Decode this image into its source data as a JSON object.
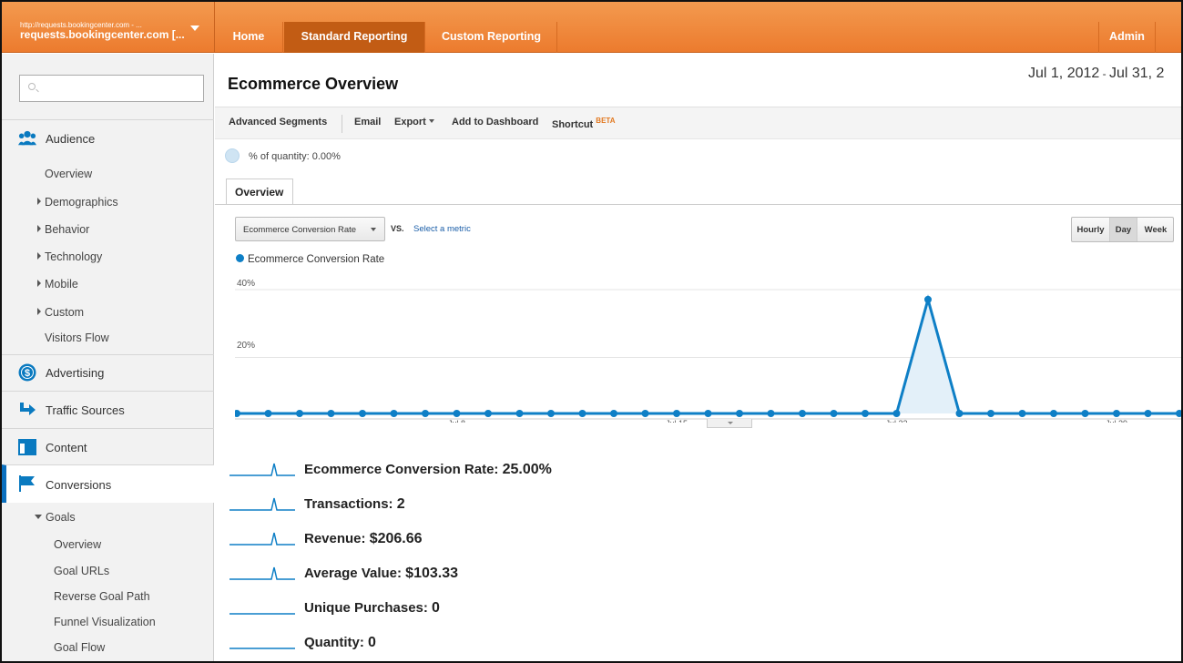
{
  "account": {
    "url": "http://requests.bookingcenter.com - ...",
    "name": "requests.bookingcenter.com [..."
  },
  "nav": {
    "home": "Home",
    "standard": "Standard Reporting",
    "custom": "Custom Reporting",
    "admin": "Admin"
  },
  "sidebar": {
    "search_placeholder": "",
    "audience": "Audience",
    "audience_items": [
      "Overview",
      "Demographics",
      "Behavior",
      "Technology",
      "Mobile",
      "Custom",
      "Visitors Flow"
    ],
    "advertising": "Advertising",
    "traffic": "Traffic Sources",
    "content": "Content",
    "conversions": "Conversions",
    "goals": "Goals",
    "goals_items": [
      "Overview",
      "Goal URLs",
      "Reverse Goal Path",
      "Funnel Visualization",
      "Goal Flow"
    ]
  },
  "page": {
    "title": "Ecommerce Overview",
    "date_start": "Jul 1, 2012",
    "date_sep": " - ",
    "date_end": "Jul 31, 2"
  },
  "toolbar": {
    "segments": "Advanced Segments",
    "email": "Email",
    "export": "Export",
    "dashboard": "Add to Dashboard",
    "shortcut": "Shortcut",
    "beta": "BETA"
  },
  "pct_quantity": "% of quantity: 0.00%",
  "tab": "Overview",
  "metric_select": "Ecommerce Conversion Rate",
  "vs": "VS.",
  "select_metric": "Select a metric",
  "granularity": {
    "hourly": "Hourly",
    "day": "Day",
    "week": "Week",
    "active": "Day"
  },
  "chart_data": {
    "type": "line",
    "series": [
      {
        "name": "Ecommerce Conversion Rate",
        "color": "#0e7fc6",
        "values": [
          0,
          0,
          0,
          0,
          0,
          0,
          0,
          0,
          0,
          0,
          0,
          0,
          0,
          0,
          0,
          0,
          0,
          0,
          0,
          0,
          0,
          0,
          35,
          0,
          0,
          0,
          0,
          0,
          0,
          0,
          0
        ]
      }
    ],
    "x": [
      1,
      2,
      3,
      4,
      5,
      6,
      7,
      8,
      9,
      10,
      11,
      12,
      13,
      14,
      15,
      16,
      17,
      18,
      19,
      20,
      21,
      22,
      23,
      24,
      25,
      26,
      27,
      28,
      29,
      30,
      31
    ],
    "x_tick_labels": [
      {
        "day": 8,
        "label": "Jul 8"
      },
      {
        "day": 15,
        "label": "Jul 15"
      },
      {
        "day": 22,
        "label": "Jul 22"
      },
      {
        "day": 29,
        "label": "Jul 29"
      }
    ],
    "y_tick_labels": [
      {
        "value": 20,
        "label": "20%"
      },
      {
        "value": 40,
        "label": "40%"
      }
    ],
    "ylim": [
      0,
      40
    ],
    "grid": true
  },
  "summary": [
    {
      "label": "Ecommerce Conversion Rate:",
      "value": "25.00%",
      "spark": "spike"
    },
    {
      "label": "Transactions:",
      "value": "2",
      "spark": "spike"
    },
    {
      "label": "Revenue:",
      "value": "$206.66",
      "spark": "spike"
    },
    {
      "label": "Average Value:",
      "value": "$103.33",
      "spark": "spike"
    },
    {
      "label": "Unique Purchases:",
      "value": "0",
      "spark": "flat"
    },
    {
      "label": "Quantity:",
      "value": "0",
      "spark": "flat"
    }
  ]
}
